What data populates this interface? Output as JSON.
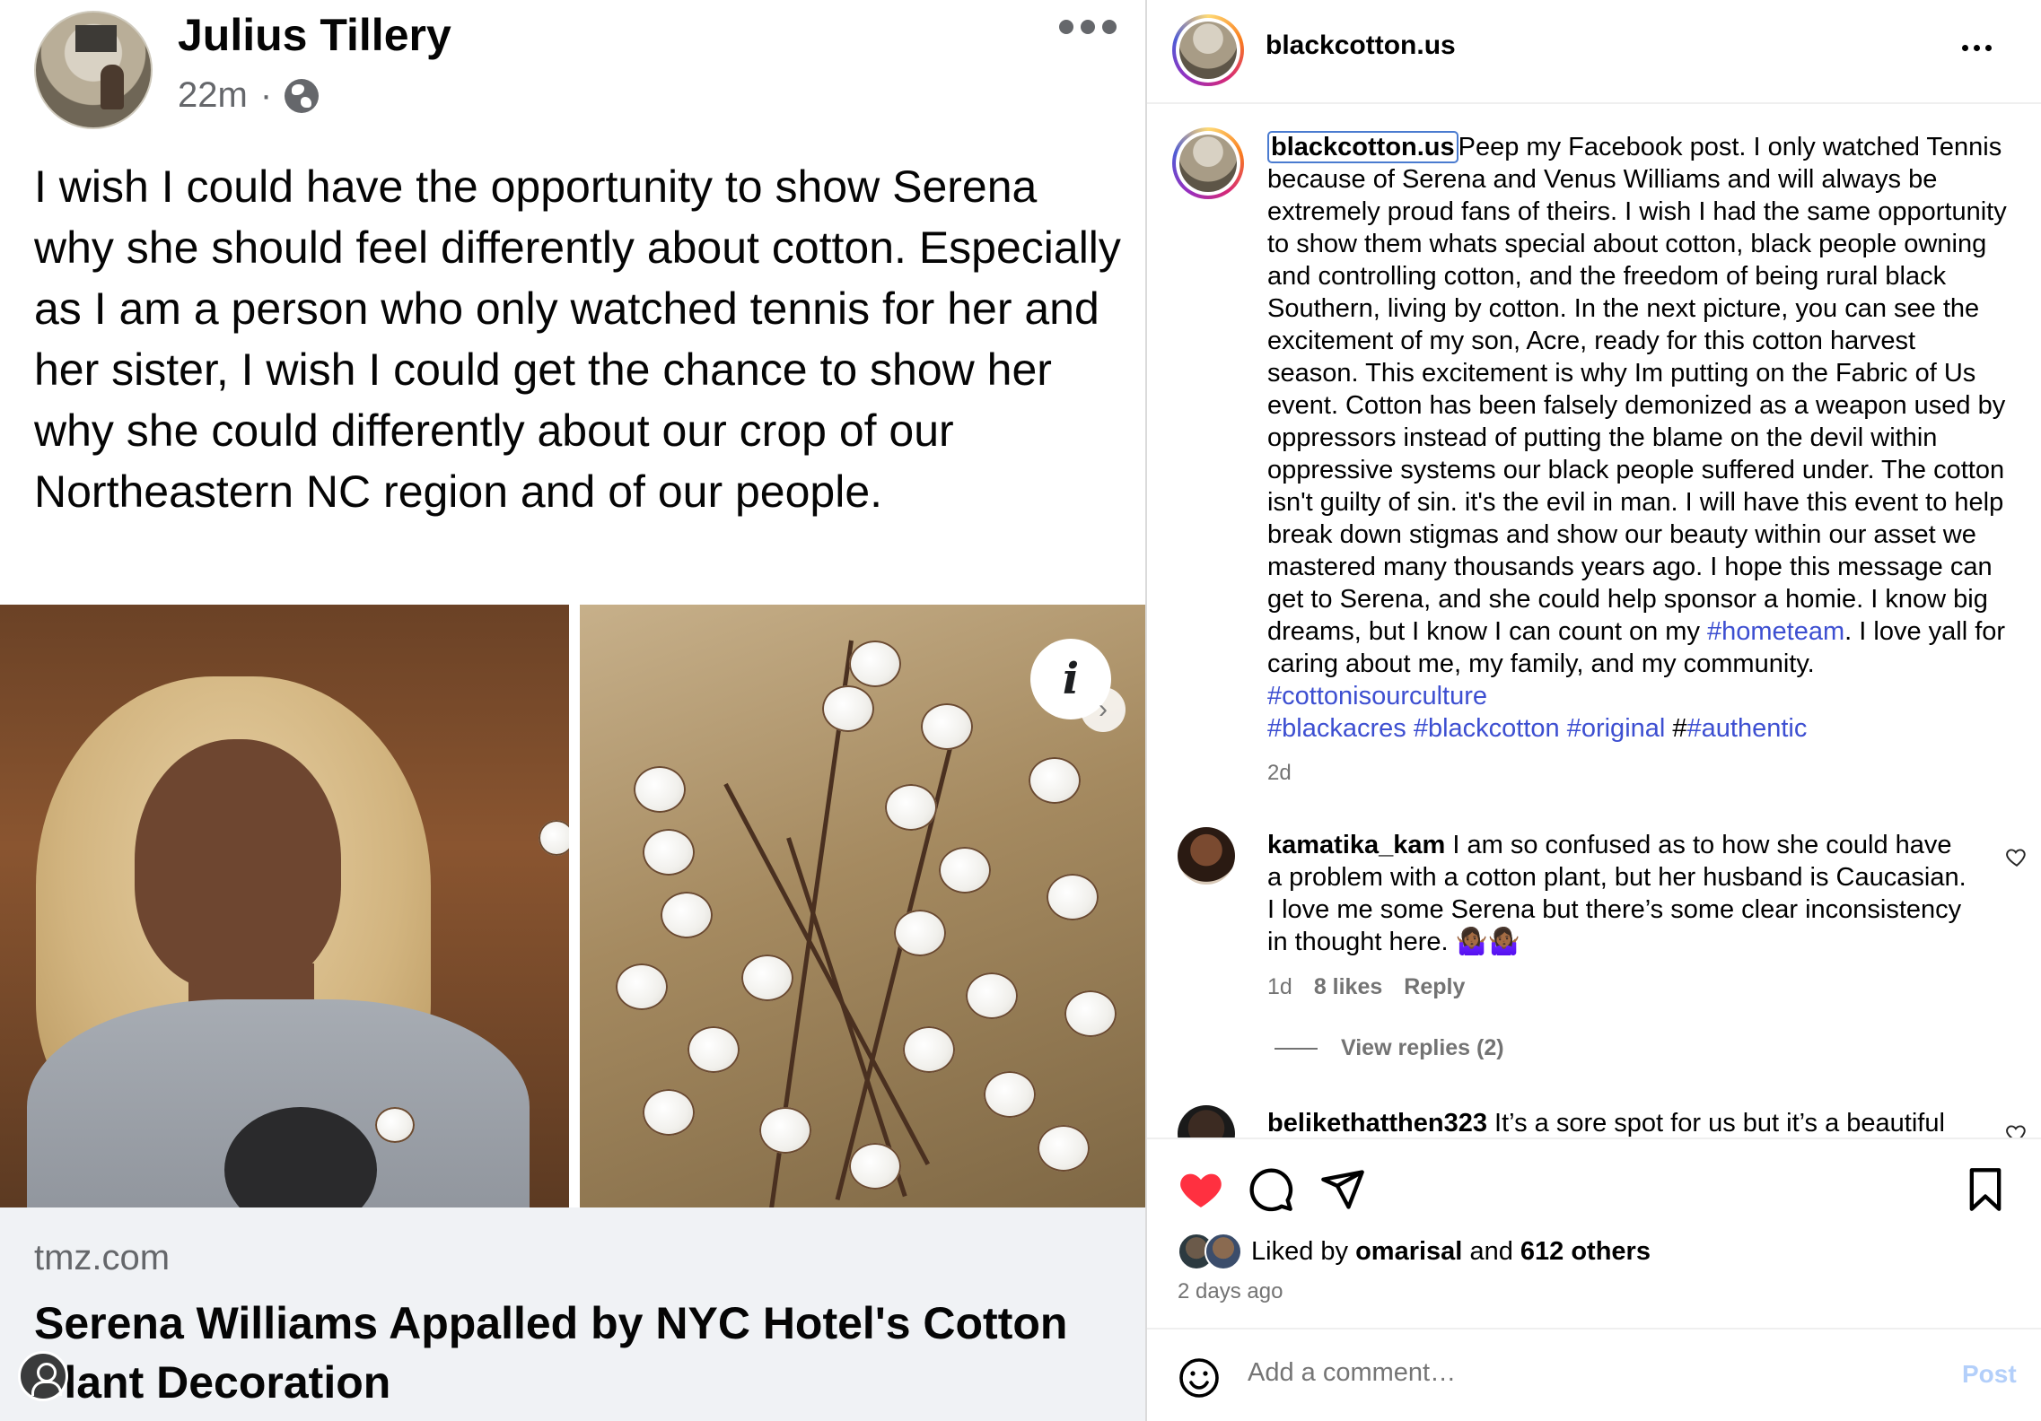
{
  "facebook": {
    "author": "Julius Tillery",
    "time": "22m",
    "separator": "·",
    "post_text": "I wish I could have the opportunity to show Serena why she should feel differently about cotton. Especially as I am a person who only watched tennis for her and her sister, I wish I could get the chance to show her why she could differently about our crop of our Northeastern NC region and of our people.",
    "info_glyph": "i",
    "next_glyph": "›",
    "link": {
      "domain": "tmz.com",
      "headline": "Serena Williams Appalled by NYC Hotel's Cotton Plant Decoration"
    }
  },
  "instagram": {
    "header_handle": "blackcotton.us",
    "caption": {
      "username": "blackcotton.us",
      "text": "Peep my Facebook post. I only watched Tennis because of Serena and Venus Williams and will always be extremely proud fans of theirs. I wish I had the same opportunity to show them whats special about cotton, black people owning and controlling cotton, and the freedom of being rural black Southern, living by cotton. In the next picture, you can see the excitement of my son, Acre, ready for this cotton harvest season. This excitement is why Im putting on the Fabric of Us event. Cotton has been falsely demonized as a weapon used by oppressors instead of putting the blame on the devil within oppressive systems our black people suffered under. The cotton isn't guilty of sin. it's the evil in man. I will have this event to help break down stigmas and show our beauty within our asset we mastered many thousands years ago. I hope this message can get to Serena, and she could help sponsor a homie. I know big dreams, but I know I can count on my ",
      "tag_hometeam": "#hometeam",
      "text2": ". I love yall for caring about me, my family, and my community. ",
      "tag_cotton_culture": "#cottonisourculture",
      "tag_blackacres": "#blackacres",
      "tag_blackcotton": "#blackcotton",
      "tag_original": "#original",
      "hash_prefix": "#",
      "tag_authentic": "#authentic",
      "age": "2d"
    },
    "comments": [
      {
        "username": "kamatika_kam",
        "text": "I am so confused as to how she could have a problem with a cotton plant, but her husband is Caucasian. I love me some Serena but there’s some clear inconsistency in thought here. 🤷🏾‍♀️🤷🏾‍♀️",
        "age": "1d",
        "likes": "8 likes",
        "reply": "Reply"
      },
      {
        "username": "belikethatthen323",
        "text": "It’s a sore spot for us but it’s a beautiful"
      }
    ],
    "view_replies": "View replies (2)",
    "liked_by_prefix": "Liked by",
    "liked_by_user": "omarisal",
    "liked_by_and": "and",
    "liked_by_others": "612 others",
    "date": "2 days ago",
    "comment_placeholder": "Add a comment…",
    "post_label": "Post",
    "colors": {
      "heart": "#ff3040",
      "hashtag": "#3d4fd1",
      "post_disabled": "#b3cffa"
    }
  }
}
